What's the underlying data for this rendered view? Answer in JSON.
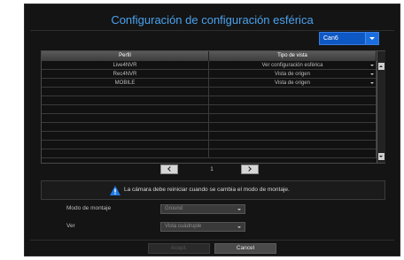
{
  "dialog": {
    "title": "Configuración de configuración esférica",
    "camera_select": {
      "value": "Can6"
    }
  },
  "table": {
    "headers": [
      "Perfil",
      "Tipo de vista"
    ],
    "rows": [
      {
        "profile": "Live4NVR",
        "view_type": "Ver configuración esférica"
      },
      {
        "profile": "Rec4NVR",
        "view_type": "Vista de origen"
      },
      {
        "profile": "MOBILE",
        "view_type": "Vista de origen"
      }
    ]
  },
  "pager": {
    "page": "1"
  },
  "warning": {
    "text": "La cámara debe reiniciar cuando se cambia el modo de montaje."
  },
  "fields": {
    "mount_mode": {
      "label": "Modo de montaje",
      "value": "Ground"
    },
    "view": {
      "label": "Ver",
      "value": "Vista cuádruple"
    }
  },
  "buttons": {
    "accept": "Acept.",
    "cancel": "Cancel"
  },
  "colors": {
    "title": "#4aa2ee",
    "select_accent": "#0e58c4",
    "warning_icon": "#1e7ae6"
  },
  "icons": {
    "warning": "warning-triangle-icon",
    "prev": "chevron-left-icon",
    "next": "chevron-right-icon"
  }
}
